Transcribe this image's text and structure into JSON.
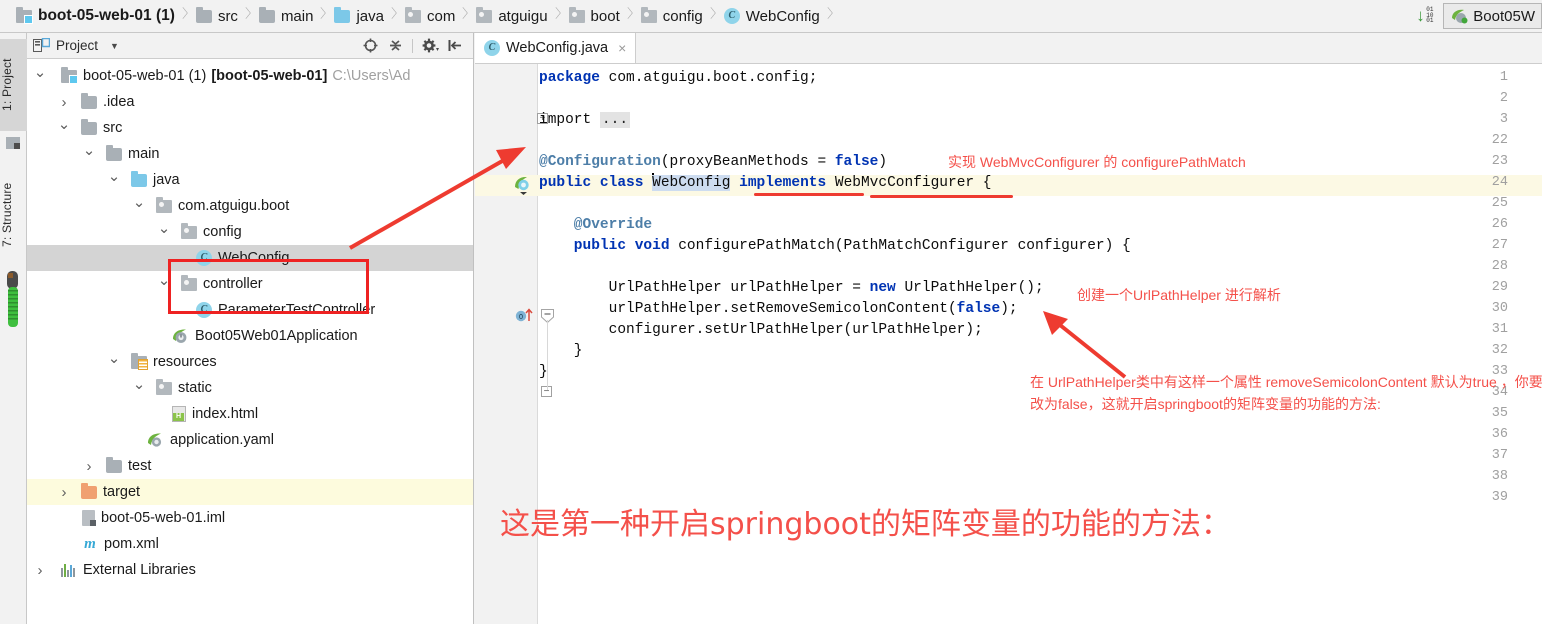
{
  "navbar": {
    "crumbs": [
      {
        "label": "boot-05-web-01 (1)",
        "icon": "module-icon",
        "bold": true
      },
      {
        "label": "src",
        "icon": "folder-icon"
      },
      {
        "label": "main",
        "icon": "folder-icon"
      },
      {
        "label": "java",
        "icon": "source-folder-icon"
      },
      {
        "label": "com",
        "icon": "package-icon"
      },
      {
        "label": "atguigu",
        "icon": "package-icon"
      },
      {
        "label": "boot",
        "icon": "package-icon"
      },
      {
        "label": "config",
        "icon": "package-icon"
      },
      {
        "label": "WebConfig",
        "icon": "class-icon"
      }
    ],
    "download_badge": "01\n10\n01",
    "run_config": "Boot05W"
  },
  "leftbar": {
    "tabs": [
      {
        "label": "1: Project",
        "selected": true
      },
      {
        "label": "7: Structure",
        "selected": false
      }
    ]
  },
  "project_panel": {
    "title": "Project",
    "tools": [
      "target-icon",
      "collapse-all-icon",
      "gear-icon",
      "hide-icon"
    ],
    "tree": [
      {
        "depth": 0,
        "chev": "down",
        "icon": "module-icon",
        "label": "boot-05-web-01 (1)",
        "suffix": "[boot-05-web-01]",
        "path": "C:\\Users\\Ad"
      },
      {
        "depth": 1,
        "chev": "right",
        "icon": "folder-icon",
        "label": ".idea"
      },
      {
        "depth": 1,
        "chev": "down",
        "icon": "folder-icon",
        "label": "src"
      },
      {
        "depth": 2,
        "chev": "down",
        "icon": "folder-icon",
        "label": "main"
      },
      {
        "depth": 3,
        "chev": "down",
        "icon": "source-folder-icon",
        "label": "java"
      },
      {
        "depth": 4,
        "chev": "down",
        "icon": "package-icon",
        "label": "com.atguigu.boot"
      },
      {
        "depth": 5,
        "chev": "down",
        "icon": "package-icon",
        "label": "config"
      },
      {
        "depth": 6,
        "chev": "none",
        "icon": "class-icon",
        "label": "WebConfig",
        "selected": true
      },
      {
        "depth": 5,
        "chev": "down",
        "icon": "package-icon",
        "label": "controller"
      },
      {
        "depth": 6,
        "chev": "none",
        "icon": "class-icon",
        "label": "ParameterTestController"
      },
      {
        "depth": 5,
        "chev": "none",
        "icon": "spring-boot-icon",
        "label": "Boot05Web01Application"
      },
      {
        "depth": 3,
        "chev": "down",
        "icon": "resources-folder-icon",
        "label": "resources"
      },
      {
        "depth": 4,
        "chev": "down",
        "icon": "package-icon",
        "label": "static"
      },
      {
        "depth": 5,
        "chev": "none",
        "icon": "html-file-icon",
        "label": "index.html"
      },
      {
        "depth": 4,
        "chev": "none",
        "icon": "spring-yaml-icon",
        "label": "application.yaml"
      },
      {
        "depth": 2,
        "chev": "right",
        "icon": "folder-icon",
        "label": "test"
      },
      {
        "depth": 1,
        "chev": "right",
        "icon": "target-folder-icon",
        "label": "target",
        "highlighted": true
      },
      {
        "depth": 2,
        "chev": "none",
        "icon": "iml-file-icon",
        "label": "boot-05-web-01.iml"
      },
      {
        "depth": 2,
        "chev": "none",
        "icon": "maven-icon",
        "label": "pom.xml"
      },
      {
        "depth": 0,
        "chev": "right",
        "icon": "library-icon",
        "label": "External Libraries"
      }
    ]
  },
  "editor": {
    "tab": {
      "label": "WebConfig.java",
      "icon": "class-icon",
      "close": "×"
    },
    "line_numbers": [
      "1",
      "2",
      "3",
      "22",
      "23",
      "24",
      "25",
      "26",
      "27",
      "28",
      "29",
      "30",
      "31",
      "32",
      "33",
      "34",
      "35",
      "36",
      "37",
      "38",
      "39"
    ],
    "lines": [
      {
        "num": "1",
        "segments": [
          {
            "t": "package ",
            "c": "kw"
          },
          {
            "t": "com.atguigu.boot.config;",
            "c": "pln"
          }
        ]
      },
      {
        "num": "2",
        "segments": []
      },
      {
        "num": "3",
        "segments": [
          {
            "t": "import ",
            "c": "pln"
          },
          {
            "t": "...",
            "c": "chip"
          }
        ]
      },
      {
        "num": "22",
        "segments": []
      },
      {
        "num": "23",
        "segments": [
          {
            "t": "@Configuration",
            "c": "ann"
          },
          {
            "t": "(proxyBeanMethods = ",
            "c": "pln"
          },
          {
            "t": "false",
            "c": "kw"
          },
          {
            "t": ")",
            "c": "pln"
          }
        ]
      },
      {
        "num": "24",
        "segments": [
          {
            "t": "public class ",
            "c": "kw"
          },
          {
            "t": "WebConfig",
            "c": "selected"
          },
          {
            "t": " ",
            "c": "pln"
          },
          {
            "t": "implements",
            "c": "kw"
          },
          {
            "t": " WebMvcConfigurer {",
            "c": "pln"
          }
        ]
      },
      {
        "num": "25",
        "segments": []
      },
      {
        "num": "26",
        "segments": [
          {
            "t": "    @Override",
            "c": "ann"
          }
        ]
      },
      {
        "num": "27",
        "segments": [
          {
            "t": "    public void ",
            "c": "kw"
          },
          {
            "t": "configurePathMatch(PathMatchConfigurer configurer) {",
            "c": "pln"
          }
        ]
      },
      {
        "num": "28",
        "segments": []
      },
      {
        "num": "29",
        "segments": [
          {
            "t": "        UrlPathHelper urlPathHelper = ",
            "c": "pln"
          },
          {
            "t": "new",
            "c": "kw"
          },
          {
            "t": " UrlPathHelper();",
            "c": "pln"
          }
        ]
      },
      {
        "num": "30",
        "segments": [
          {
            "t": "        urlPathHelper.setRemoveSemicolonContent(",
            "c": "pln"
          },
          {
            "t": "false",
            "c": "kw"
          },
          {
            "t": ");",
            "c": "pln"
          }
        ]
      },
      {
        "num": "31",
        "segments": [
          {
            "t": "        configurer.setUrlPathHelper(urlPathHelper);",
            "c": "pln"
          }
        ]
      },
      {
        "num": "32",
        "segments": [
          {
            "t": "    }",
            "c": "pln"
          }
        ]
      },
      {
        "num": "33",
        "segments": [
          {
            "t": "}",
            "c": "pln"
          }
        ]
      },
      {
        "num": "34",
        "segments": []
      },
      {
        "num": "35",
        "segments": []
      },
      {
        "num": "36",
        "segments": []
      },
      {
        "num": "37",
        "segments": []
      },
      {
        "num": "38",
        "segments": []
      },
      {
        "num": "39",
        "segments": []
      }
    ]
  },
  "annotations": {
    "note_1": "实现 WebMvcConfigurer 的 configurePathMatch",
    "note_2": "创建一个UrlPathHelper 进行解析",
    "note_3_line1": "在 UrlPathHelper类中有这样一个属性 removeSemicolonContent 默认为true ，你要",
    "note_3_line2": "改为false，这就开启springboot的矩阵变量的功能的方法:",
    "big_note": "这是第一种开启springboot的矩阵变量的功能的方法："
  },
  "colors": {
    "annotation_red": "#f4504a",
    "rect_red": "#ee2222",
    "keyword_blue": "#0033b3",
    "annotation_blue": "#4d7ea8",
    "selection_blue": "#cddcf0",
    "row_highlight": "#fcf9e4",
    "tree_selection": "#d4d4d4"
  }
}
